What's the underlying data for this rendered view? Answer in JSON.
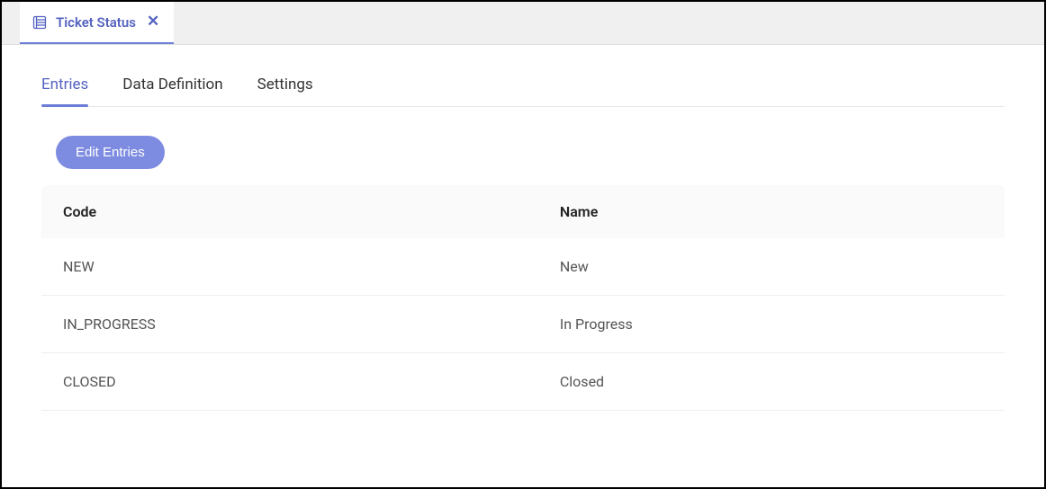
{
  "tab": {
    "title": "Ticket Status"
  },
  "nav": {
    "tabs": [
      {
        "label": "Entries",
        "active": true
      },
      {
        "label": "Data Definition",
        "active": false
      },
      {
        "label": "Settings",
        "active": false
      }
    ]
  },
  "actions": {
    "edit_label": "Edit Entries"
  },
  "table": {
    "headers": {
      "code": "Code",
      "name": "Name"
    },
    "rows": [
      {
        "code": "NEW",
        "name": "New"
      },
      {
        "code": "IN_PROGRESS",
        "name": "In Progress"
      },
      {
        "code": "CLOSED",
        "name": "Closed"
      }
    ]
  }
}
